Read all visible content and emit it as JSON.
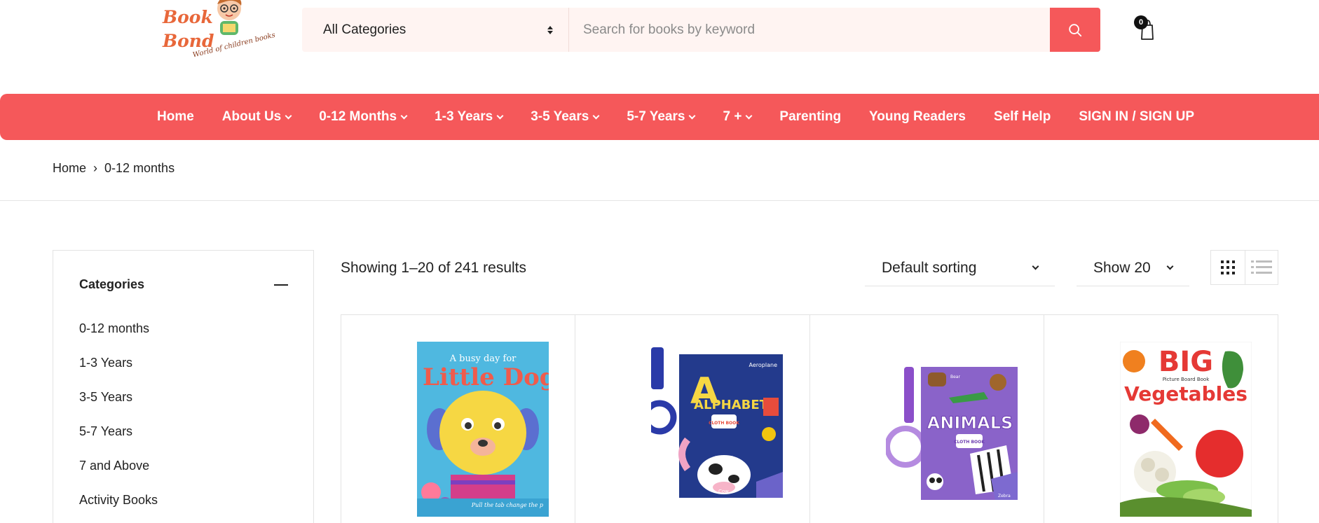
{
  "brand": {
    "line1": "Book",
    "line2": "Bond",
    "tagline": "World of children books"
  },
  "search": {
    "category": "All Categories",
    "placeholder": "Search for books by keyword"
  },
  "cart": {
    "count": "0"
  },
  "nav": [
    {
      "label": "Home",
      "dropdown": false
    },
    {
      "label": "About Us",
      "dropdown": true
    },
    {
      "label": "0-12 Months",
      "dropdown": true
    },
    {
      "label": "1-3 Years",
      "dropdown": true
    },
    {
      "label": "3-5 Years",
      "dropdown": true
    },
    {
      "label": "5-7 Years",
      "dropdown": true
    },
    {
      "label": "7 +",
      "dropdown": true
    },
    {
      "label": "Parenting",
      "dropdown": false
    },
    {
      "label": "Young Readers",
      "dropdown": false
    },
    {
      "label": "Self Help",
      "dropdown": false
    },
    {
      "label": "SIGN IN / SIGN UP",
      "dropdown": false
    }
  ],
  "breadcrumb": {
    "home": "Home",
    "separator": "›",
    "current": "0-12 months"
  },
  "sidebar": {
    "title": "Categories",
    "items": [
      "0-12 months",
      "1-3 Years",
      "3-5 Years",
      "5-7 Years",
      "7 and Above",
      "Activity Books"
    ]
  },
  "toolbar": {
    "results": "Showing 1–20 of 241 results",
    "sort": "Default sorting",
    "show": "Show 20"
  },
  "products": [
    {
      "cover_top": "A busy day for",
      "cover_title": "Little Dog",
      "cover_note": "Pull the tab change the p",
      "bg": "#4fb8e0"
    },
    {
      "cover_top": "Aeroplane",
      "cover_title": "ALPHABET",
      "badge": "CLOTH BOOK",
      "cover_note": "Cow",
      "bg": "#233a8c"
    },
    {
      "cover_top": "Bear",
      "cover_title": "ANIMALS",
      "badge": "CLOTH BOOK",
      "cover_note": "Zebra",
      "bg": "#8a63c9"
    },
    {
      "cover_top": "BIG",
      "cover_title": "Vegetables",
      "cover_sub": "Picture Board Book",
      "bg": "#ffffff"
    }
  ],
  "colors": {
    "brand_red": "#f5585a",
    "logo_orange": "#e8673a",
    "input_bg": "#fff4f2"
  }
}
